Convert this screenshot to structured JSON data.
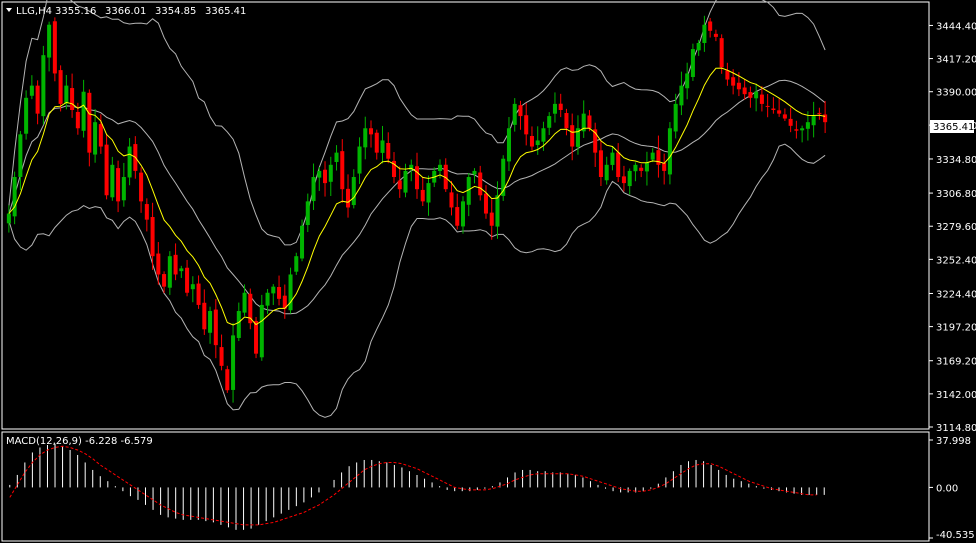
{
  "chart_data": [
    {
      "type": "candlestick",
      "title": "LLG,H4",
      "ohlc_readout": {
        "open": "3355.16",
        "high": "3366.01",
        "low": "3354.85",
        "close": "3365.41"
      },
      "current_price": "3365.41",
      "y_ticks": [
        "3444.40",
        "3417.20",
        "3390.00",
        "3362.60",
        "3334.80",
        "3306.80",
        "3279.60",
        "3252.40",
        "3224.40",
        "3197.20",
        "3169.20",
        "3142.00",
        "3114.80"
      ],
      "ylim": [
        3114.8,
        3462
      ],
      "grid": false,
      "colors": {
        "bull": "#00b400",
        "bear": "#ff0000",
        "ma": "#ffff00",
        "bands": "#b4b4b4",
        "background": "#000000"
      },
      "overlays": [
        "Bollinger Bands",
        "Moving Average"
      ],
      "series": [
        {
          "name": "price",
          "values": [
            3290,
            3320,
            3355,
            3385,
            3395,
            3372,
            3420,
            3445,
            3405,
            3380,
            3395,
            3375,
            3360,
            3390,
            3340,
            3365,
            3345,
            3305,
            3330,
            3300,
            3320,
            3345,
            3325,
            3300,
            3285,
            3255,
            3240,
            3230,
            3255,
            3240,
            3245,
            3225,
            3232,
            3215,
            3195,
            3210,
            3182,
            3165,
            3145,
            3190,
            3210,
            3225,
            3200,
            3175,
            3215,
            3225,
            3230,
            3220,
            3212,
            3240,
            3255,
            3280,
            3300,
            3320,
            3325,
            3315,
            3330,
            3340,
            3310,
            3295,
            3320,
            3345,
            3360,
            3355,
            3340,
            3350,
            3335,
            3320,
            3310,
            3325,
            3330,
            3310,
            3300,
            3315,
            3325,
            3330,
            3310,
            3295,
            3280,
            3300,
            3320,
            3325,
            3305,
            3290,
            3280,
            3305,
            3335,
            3360,
            3380,
            3370,
            3355,
            3345,
            3350,
            3360,
            3370,
            3380,
            3375,
            3360,
            3345,
            3360,
            3372,
            3360,
            3340,
            3320,
            3330,
            3340,
            3320,
            3315,
            3325,
            3330,
            3325,
            3332,
            3340,
            3330,
            3325,
            3360,
            3380,
            3395,
            3405,
            3425,
            3430,
            3445,
            3440,
            3435,
            3410,
            3400,
            3395,
            3392,
            3388,
            3385,
            3390,
            3380,
            3378,
            3375,
            3372,
            3368,
            3362,
            3358,
            3360,
            3365,
            3370,
            3372,
            3365
          ]
        }
      ]
    },
    {
      "type": "bar",
      "title": "MACD(12,26,9) -6.228 -6.579",
      "y_ticks": [
        "37.998",
        "0.00",
        "-40.535"
      ],
      "ylim": [
        -40.535,
        37.998
      ],
      "colors": {
        "histogram": "#ffffff",
        "signal": "#ff0000"
      },
      "series": [
        {
          "name": "MACD",
          "values": [
            2,
            10,
            20,
            28,
            32,
            34,
            35,
            33,
            30,
            26,
            20,
            14,
            9,
            5,
            1,
            -3,
            -7,
            -10,
            -14,
            -18,
            -22,
            -24,
            -25,
            -26,
            -26,
            -26,
            -27,
            -28,
            -30,
            -32,
            -34,
            -34,
            -33,
            -30,
            -27,
            -24,
            -21,
            -18,
            -15,
            -12,
            -8,
            -4,
            0,
            6,
            12,
            17,
            20,
            22,
            22,
            21,
            20,
            18,
            16,
            13,
            10,
            7,
            4,
            1,
            -2,
            -3,
            -3,
            -3,
            -2,
            -1,
            1,
            4,
            8,
            12,
            14,
            14,
            13,
            13,
            12,
            12,
            11,
            10,
            8,
            5,
            2,
            -1,
            -3,
            -4,
            -4,
            -4,
            -3,
            -1,
            3,
            8,
            13,
            18,
            21,
            22,
            21,
            18,
            14,
            10,
            7,
            5,
            3,
            1,
            -1,
            -2,
            -3,
            -4,
            -5,
            -6,
            -6,
            -6,
            -6
          ]
        },
        {
          "name": "Signal",
          "values": [
            -8,
            2,
            12,
            20,
            26,
            30,
            32,
            33,
            32,
            30,
            27,
            23,
            18,
            14,
            10,
            6,
            2,
            -2,
            -6,
            -10,
            -14,
            -17,
            -20,
            -22,
            -23,
            -24,
            -25,
            -26,
            -27,
            -28,
            -29,
            -30,
            -30,
            -30,
            -29,
            -28,
            -26,
            -24,
            -22,
            -20,
            -17,
            -14,
            -10,
            -6,
            -1,
            4,
            9,
            14,
            17,
            19,
            20,
            20,
            19,
            17,
            15,
            12,
            9,
            6,
            3,
            0,
            -1,
            -2,
            -2,
            -2,
            -1,
            1,
            3,
            6,
            8,
            10,
            11,
            11,
            11,
            11,
            11,
            10,
            9,
            7,
            5,
            3,
            1,
            -1,
            -2,
            -3,
            -3,
            -2,
            0,
            3,
            7,
            11,
            15,
            18,
            19,
            19,
            17,
            14,
            11,
            8,
            5,
            3,
            1,
            -1,
            -2,
            -3,
            -4,
            -5,
            -6,
            -6
          ]
        }
      ]
    }
  ]
}
